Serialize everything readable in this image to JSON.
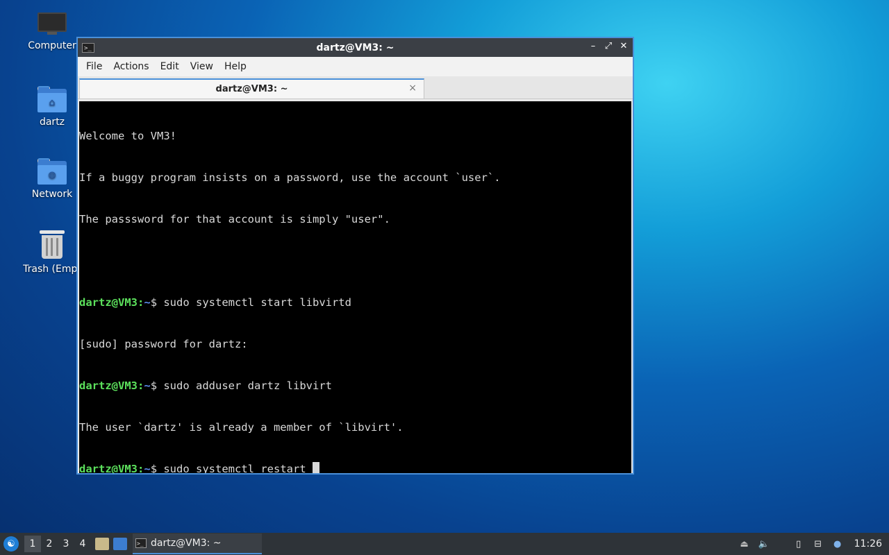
{
  "desktop": {
    "icons": [
      {
        "label": "Computer"
      },
      {
        "label": "dartz"
      },
      {
        "label": "Network"
      },
      {
        "label": "Trash (Empt"
      }
    ]
  },
  "window": {
    "title": "dartz@VM3: ~",
    "controls": {
      "minimize": "–",
      "maximize": "⤢",
      "close": "✕"
    },
    "menu": [
      "File",
      "Actions",
      "Edit",
      "View",
      "Help"
    ],
    "tab": {
      "label": "dartz@VM3: ~",
      "close": "×"
    }
  },
  "terminal": {
    "lines": [
      {
        "text": "Welcome to VM3!"
      },
      {
        "text": "If a buggy program insists on a password, use the account `user`."
      },
      {
        "text": "The passsword for that account is simply \"user\"."
      },
      {
        "text": ""
      },
      {
        "user": "dartz@VM3",
        "path": "~",
        "cmd": "$ sudo systemctl start libvirtd"
      },
      {
        "text": "[sudo] password for dartz:"
      },
      {
        "user": "dartz@VM3",
        "path": "~",
        "cmd": "$ sudo adduser dartz libvirt"
      },
      {
        "text": "The user `dartz' is already a member of `libvirt'."
      },
      {
        "user": "dartz@VM3",
        "path": "~",
        "cmd": "$ sudo systemctl restart "
      }
    ]
  },
  "taskbar": {
    "workspaces": [
      "1",
      "2",
      "3",
      "4"
    ],
    "active_workspace": "1",
    "task": {
      "label": "dartz@VM3: ~"
    },
    "clock": "11:26"
  },
  "colors": {
    "accent": "#4a90d9",
    "prompt_user": "#5ce05c",
    "prompt_path": "#5c8cf0",
    "terminal_bg": "#000000"
  }
}
